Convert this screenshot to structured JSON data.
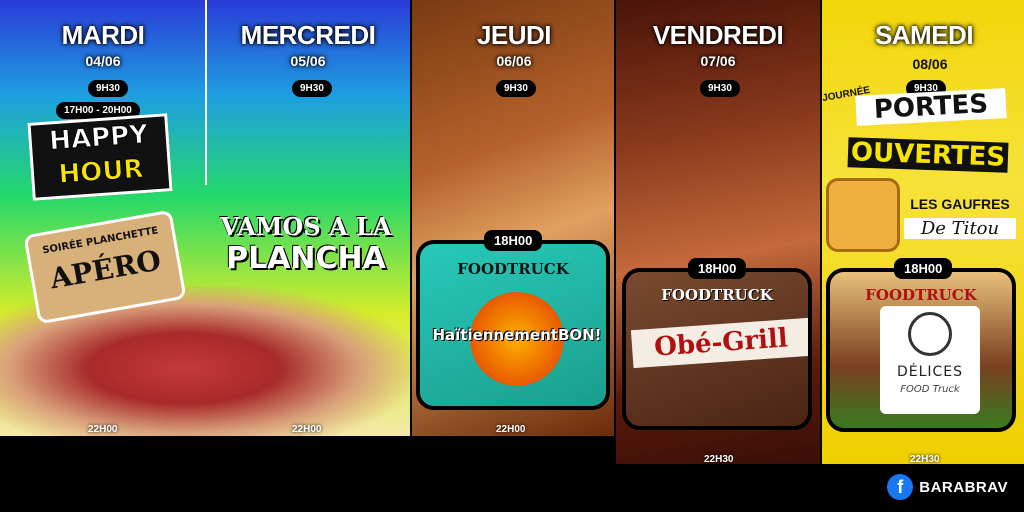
{
  "days": [
    {
      "name": "MARDI",
      "date": "04/06",
      "start": "9H30",
      "end": "22H00"
    },
    {
      "name": "MERCREDI",
      "date": "05/06",
      "start": "9H30",
      "end": "22H00"
    },
    {
      "name": "JEUDI",
      "date": "06/06",
      "start": "9H30",
      "event_time": "18H00",
      "end": "22H00"
    },
    {
      "name": "VENDREDI",
      "date": "07/06",
      "start": "9H30",
      "event_time": "18H00",
      "end": "22H30"
    },
    {
      "name": "SAMEDI",
      "date": "08/06",
      "start": "9H30",
      "event_time": "18H00",
      "end": "22H30"
    }
  ],
  "mardi": {
    "happy_time": "17H00 - 20H00",
    "happy_line1": "HAPPY",
    "happy_line2": "HOUR",
    "board_small": "SOIRÉE PLANCHETTE",
    "board_big": "APÉRO"
  },
  "mercredi": {
    "line1": "VAMOS A LA",
    "line2": "PLANCHA"
  },
  "jeudi": {
    "truck_label": "FOODTRUCK",
    "truck_name": "HaïtiennementBON!"
  },
  "vendredi": {
    "truck_label": "FOODTRUCK",
    "truck_name": "Obé-Grill"
  },
  "samedi": {
    "journee": "JOURNÉE",
    "portes": "PORTES",
    "ouvertes": "OUVERTES",
    "gaufres": "LES GAUFRES",
    "titou": "De Titou",
    "truck_label": "FOODTRUCK",
    "truck_name": "DÉLICES",
    "truck_sub": "FOOD Truck"
  },
  "footer": {
    "icon": "facebook-icon",
    "brand": "BARABRAV"
  },
  "colors": {
    "facebook": "#1877f2",
    "accent_yellow": "#f7e400",
    "background": "#000000"
  }
}
